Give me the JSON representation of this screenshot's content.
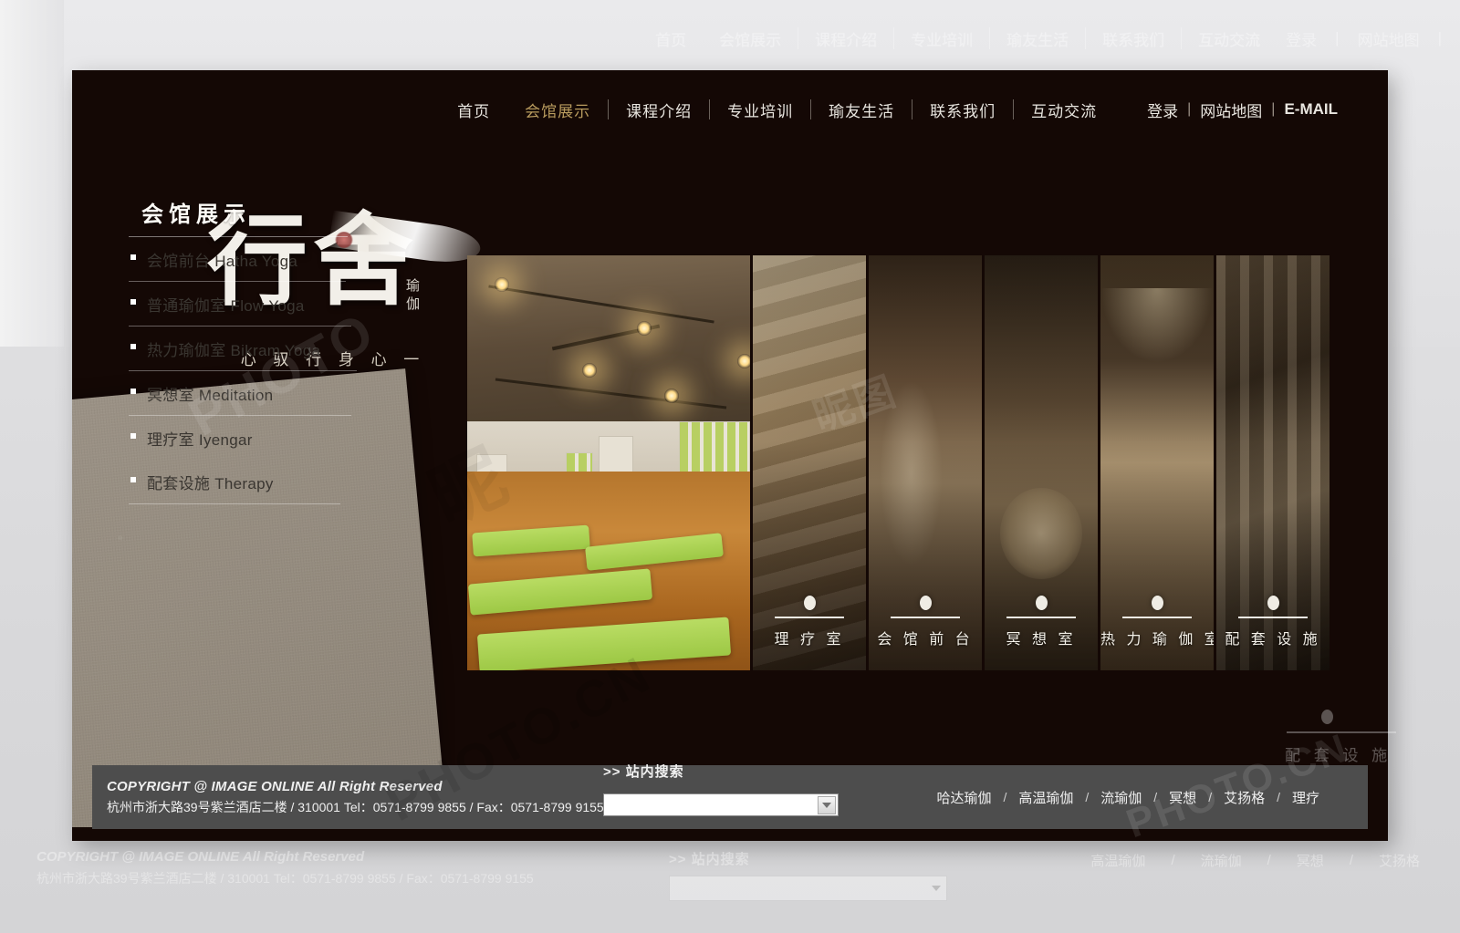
{
  "site": {
    "brand": {
      "logo_main": "行舍",
      "logo_sub": "瑜伽",
      "tagline": "心 驭 行  身 心 一"
    },
    "nav": {
      "items": [
        {
          "label": "首页",
          "active": false
        },
        {
          "label": "会馆展示",
          "active": true
        },
        {
          "label": "课程介绍",
          "active": false
        },
        {
          "label": "专业培训",
          "active": false
        },
        {
          "label": "瑜友生活",
          "active": false
        },
        {
          "label": "联系我们",
          "active": false
        },
        {
          "label": "互动交流",
          "active": false
        }
      ],
      "login": "登录",
      "sep1": "|",
      "sitemap": "网站地图",
      "sep2": "|",
      "email": "E-MAIL",
      "accent_color": "#b89b5e"
    },
    "sidebar": {
      "title": "会馆展示",
      "items": [
        {
          "label": "会馆前台 Hatha Yoga"
        },
        {
          "label": "普通瑜伽室 Flow Yoga"
        },
        {
          "label": "热力瑜伽室 Bikram Yoga"
        },
        {
          "label": "冥想室 Meditation"
        },
        {
          "label": "理疗室 Iyengar"
        },
        {
          "label": "配套设施 Therapy"
        }
      ]
    },
    "gallery": {
      "hero_caption": "",
      "thumbs": [
        {
          "label": "理 疗 室"
        },
        {
          "label": "会 馆 前 台"
        },
        {
          "label": "冥 想 室"
        },
        {
          "label": "热 力 瑜 伽 室"
        },
        {
          "label": "配 套 设 施"
        }
      ]
    },
    "footer": {
      "copyright": "COPYRIGHT @  IMAGE ONLINE All Right Reserved",
      "address": "杭州市浙大路39号紫兰酒店二楼 / 310001  Tel：0571-8799 9855  / Fax：0571-8799 9155",
      "search_label": ">> 站内搜索",
      "search_value": "",
      "search_placeholder": "",
      "links": [
        {
          "label": "哈达瑜伽"
        },
        {
          "label": "高温瑜伽"
        },
        {
          "label": "流瑜伽"
        },
        {
          "label": "冥想"
        },
        {
          "label": "艾扬格"
        },
        {
          "label": "理疗"
        }
      ],
      "link_separator": "/"
    }
  },
  "ghost": {
    "nav_items": [
      {
        "label": "首页"
      },
      {
        "label": "会馆展示"
      },
      {
        "label": "课程介绍"
      },
      {
        "label": "专业培训"
      },
      {
        "label": "瑜友生活"
      },
      {
        "label": "联系我们"
      },
      {
        "label": "互动交流"
      },
      {
        "label": "登录"
      },
      {
        "label": "|"
      },
      {
        "label": "网站地图"
      },
      {
        "label": "|"
      }
    ],
    "thumb_label": "配 套 设 施"
  }
}
